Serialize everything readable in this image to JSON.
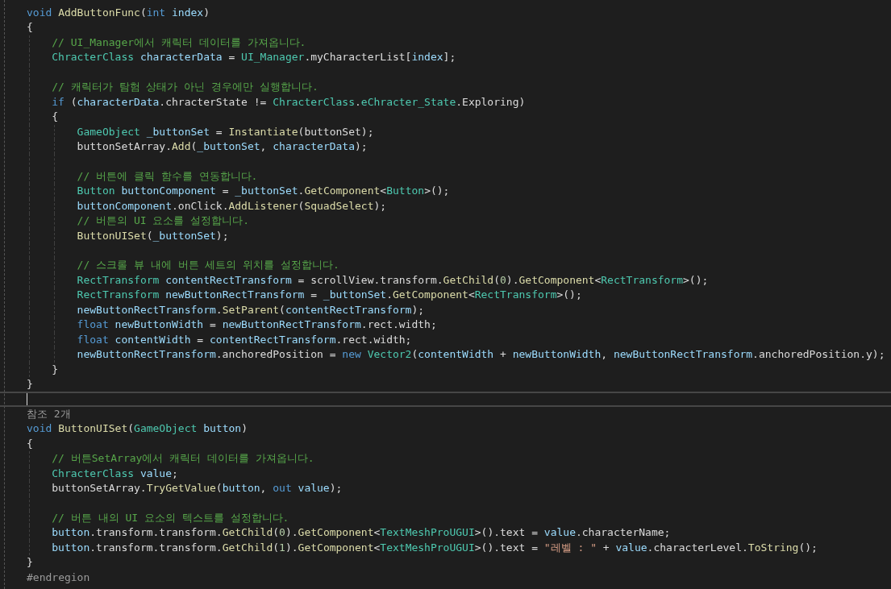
{
  "editor": {
    "lines": [
      {
        "current": false,
        "tokens": [
          {
            "text": "void ",
            "kind": "keyword"
          },
          {
            "text": "AddButtonFunc",
            "kind": "method"
          },
          {
            "text": "(",
            "kind": "plain"
          },
          {
            "text": "int ",
            "kind": "keyword"
          },
          {
            "text": "index",
            "kind": "variable"
          },
          {
            "text": ")",
            "kind": "plain"
          }
        ]
      },
      {
        "current": false,
        "tokens": [
          {
            "text": "{",
            "kind": "plain"
          }
        ],
        "children": [
          {
            "current": false,
            "tokens": [
              {
                "text": "// UI_Manager에서 캐릭터 데이터를 가져옵니다.",
                "kind": "comment"
              }
            ]
          },
          {
            "current": false,
            "tokens": [
              {
                "text": "ChracterClass ",
                "kind": "type"
              },
              {
                "text": "characterData",
                "kind": "variable"
              },
              {
                "text": " = ",
                "kind": "plain"
              },
              {
                "text": "UI_Manager",
                "kind": "type"
              },
              {
                "text": ".myCharacterList[",
                "kind": "plain"
              },
              {
                "text": "index",
                "kind": "variable"
              },
              {
                "text": "];",
                "kind": "plain"
              }
            ]
          },
          {
            "current": false
          },
          {
            "current": false,
            "tokens": [
              {
                "text": "// 캐릭터가 탐험 상태가 아닌 경우에만 실행합니다.",
                "kind": "comment"
              }
            ]
          },
          {
            "current": false,
            "tokens": [
              {
                "text": "if",
                "kind": "keyword"
              },
              {
                "text": " (",
                "kind": "plain"
              },
              {
                "text": "characterData",
                "kind": "variable"
              },
              {
                "text": ".chracterState != ",
                "kind": "plain"
              },
              {
                "text": "ChracterClass",
                "kind": "type"
              },
              {
                "text": ".",
                "kind": "plain"
              },
              {
                "text": "eChracter_State",
                "kind": "type"
              },
              {
                "text": ".Exploring)",
                "kind": "plain"
              }
            ]
          },
          {
            "current": false,
            "tokens": [
              {
                "text": "{",
                "kind": "plain"
              }
            ],
            "children": [
              {
                "current": false,
                "tokens": [
                  {
                    "text": "GameObject ",
                    "kind": "type"
                  },
                  {
                    "text": "_buttonSet",
                    "kind": "variable"
                  },
                  {
                    "text": " = ",
                    "kind": "plain"
                  },
                  {
                    "text": "Instantiate",
                    "kind": "method"
                  },
                  {
                    "text": "(buttonSet);",
                    "kind": "plain"
                  }
                ]
              },
              {
                "current": false,
                "tokens": [
                  {
                    "text": "buttonSetArray.",
                    "kind": "plain"
                  },
                  {
                    "text": "Add",
                    "kind": "method"
                  },
                  {
                    "text": "(",
                    "kind": "plain"
                  },
                  {
                    "text": "_buttonSet",
                    "kind": "variable"
                  },
                  {
                    "text": ", ",
                    "kind": "plain"
                  },
                  {
                    "text": "characterData",
                    "kind": "variable"
                  },
                  {
                    "text": ");",
                    "kind": "plain"
                  }
                ]
              },
              {
                "current": false
              },
              {
                "current": false,
                "tokens": [
                  {
                    "text": "// 버튼에 클릭 함수를 연동합니다.",
                    "kind": "comment"
                  }
                ]
              },
              {
                "current": false,
                "tokens": [
                  {
                    "text": "Button ",
                    "kind": "type"
                  },
                  {
                    "text": "buttonComponent",
                    "kind": "variable"
                  },
                  {
                    "text": " = ",
                    "kind": "plain"
                  },
                  {
                    "text": "_buttonSet",
                    "kind": "variable"
                  },
                  {
                    "text": ".",
                    "kind": "plain"
                  },
                  {
                    "text": "GetComponent",
                    "kind": "method"
                  },
                  {
                    "text": "<",
                    "kind": "plain"
                  },
                  {
                    "text": "Button",
                    "kind": "type"
                  },
                  {
                    "text": ">();",
                    "kind": "plain"
                  }
                ]
              },
              {
                "current": false,
                "tokens": [
                  {
                    "text": "buttonComponent",
                    "kind": "variable"
                  },
                  {
                    "text": ".onClick.",
                    "kind": "plain"
                  },
                  {
                    "text": "AddListener",
                    "kind": "method"
                  },
                  {
                    "text": "(",
                    "kind": "plain"
                  },
                  {
                    "text": "SquadSelect",
                    "kind": "method"
                  },
                  {
                    "text": ");",
                    "kind": "plain"
                  }
                ]
              },
              {
                "current": false,
                "tokens": [
                  {
                    "text": "// 버튼의 UI 요소를 설정합니다.",
                    "kind": "comment"
                  }
                ]
              },
              {
                "current": false,
                "tokens": [
                  {
                    "text": "ButtonUISet",
                    "kind": "method"
                  },
                  {
                    "text": "(",
                    "kind": "plain"
                  },
                  {
                    "text": "_buttonSet",
                    "kind": "variable"
                  },
                  {
                    "text": ");",
                    "kind": "plain"
                  }
                ]
              },
              {
                "current": false
              },
              {
                "current": false,
                "tokens": [
                  {
                    "text": "// 스크롤 뷰 내에 버튼 세트의 위치를 설정합니다.",
                    "kind": "comment"
                  }
                ]
              },
              {
                "current": false,
                "tokens": [
                  {
                    "text": "RectTransform ",
                    "kind": "type"
                  },
                  {
                    "text": "contentRectTransform",
                    "kind": "variable"
                  },
                  {
                    "text": " = scrollView.transform.",
                    "kind": "plain"
                  },
                  {
                    "text": "GetChild",
                    "kind": "method"
                  },
                  {
                    "text": "(",
                    "kind": "plain"
                  },
                  {
                    "text": "0",
                    "kind": "number"
                  },
                  {
                    "text": ").",
                    "kind": "plain"
                  },
                  {
                    "text": "GetComponent",
                    "kind": "method"
                  },
                  {
                    "text": "<",
                    "kind": "plain"
                  },
                  {
                    "text": "RectTransform",
                    "kind": "type"
                  },
                  {
                    "text": ">();",
                    "kind": "plain"
                  }
                ]
              },
              {
                "current": false,
                "tokens": [
                  {
                    "text": "RectTransform ",
                    "kind": "type"
                  },
                  {
                    "text": "newButtonRectTransform",
                    "kind": "variable"
                  },
                  {
                    "text": " = ",
                    "kind": "plain"
                  },
                  {
                    "text": "_buttonSet",
                    "kind": "variable"
                  },
                  {
                    "text": ".",
                    "kind": "plain"
                  },
                  {
                    "text": "GetComponent",
                    "kind": "method"
                  },
                  {
                    "text": "<",
                    "kind": "plain"
                  },
                  {
                    "text": "RectTransform",
                    "kind": "type"
                  },
                  {
                    "text": ">();",
                    "kind": "plain"
                  }
                ]
              },
              {
                "current": false,
                "tokens": [
                  {
                    "text": "newButtonRectTransform",
                    "kind": "variable"
                  },
                  {
                    "text": ".",
                    "kind": "plain"
                  },
                  {
                    "text": "SetParent",
                    "kind": "method"
                  },
                  {
                    "text": "(",
                    "kind": "plain"
                  },
                  {
                    "text": "contentRectTransform",
                    "kind": "variable"
                  },
                  {
                    "text": ");",
                    "kind": "plain"
                  }
                ]
              },
              {
                "current": false,
                "tokens": [
                  {
                    "text": "float ",
                    "kind": "keyword"
                  },
                  {
                    "text": "newButtonWidth",
                    "kind": "variable"
                  },
                  {
                    "text": " = ",
                    "kind": "plain"
                  },
                  {
                    "text": "newButtonRectTransform",
                    "kind": "variable"
                  },
                  {
                    "text": ".rect.width;",
                    "kind": "plain"
                  }
                ]
              },
              {
                "current": false,
                "tokens": [
                  {
                    "text": "float ",
                    "kind": "keyword"
                  },
                  {
                    "text": "contentWidth",
                    "kind": "variable"
                  },
                  {
                    "text": " = ",
                    "kind": "plain"
                  },
                  {
                    "text": "contentRectTransform",
                    "kind": "variable"
                  },
                  {
                    "text": ".rect.width;",
                    "kind": "plain"
                  }
                ]
              },
              {
                "current": false,
                "tokens": [
                  {
                    "text": "newButtonRectTransform",
                    "kind": "variable"
                  },
                  {
                    "text": ".anchoredPosition = ",
                    "kind": "plain"
                  },
                  {
                    "text": "new ",
                    "kind": "keyword"
                  },
                  {
                    "text": "Vector2",
                    "kind": "type"
                  },
                  {
                    "text": "(",
                    "kind": "plain"
                  },
                  {
                    "text": "contentWidth",
                    "kind": "variable"
                  },
                  {
                    "text": " + ",
                    "kind": "plain"
                  },
                  {
                    "text": "newButtonWidth",
                    "kind": "variable"
                  },
                  {
                    "text": ", ",
                    "kind": "plain"
                  },
                  {
                    "text": "newButtonRectTransform",
                    "kind": "variable"
                  },
                  {
                    "text": ".anchoredPosition.y);",
                    "kind": "plain"
                  }
                ]
              }
            ]
          },
          {
            "current": false,
            "tokens": [
              {
                "text": "}",
                "kind": "plain"
              }
            ]
          }
        ]
      },
      {
        "current": false,
        "tokens": [
          {
            "text": "}",
            "kind": "plain"
          }
        ]
      },
      {
        "current": true
      },
      {
        "current": false,
        "tokens": [
          {
            "text": "참조 2개",
            "kind": "lens"
          }
        ]
      },
      {
        "current": false,
        "tokens": [
          {
            "text": "void ",
            "kind": "keyword"
          },
          {
            "text": "ButtonUISet",
            "kind": "method"
          },
          {
            "text": "(",
            "kind": "plain"
          },
          {
            "text": "GameObject ",
            "kind": "type"
          },
          {
            "text": "button",
            "kind": "variable"
          },
          {
            "text": ")",
            "kind": "plain"
          }
        ]
      },
      {
        "current": false,
        "tokens": [
          {
            "text": "{",
            "kind": "plain"
          }
        ],
        "children": [
          {
            "current": false,
            "tokens": [
              {
                "text": "// 버튼SetArray에서 캐릭터 데이터를 가져옵니다.",
                "kind": "comment"
              }
            ]
          },
          {
            "current": false,
            "tokens": [
              {
                "text": "ChracterClass ",
                "kind": "type"
              },
              {
                "text": "value",
                "kind": "variable"
              },
              {
                "text": ";",
                "kind": "plain"
              }
            ]
          },
          {
            "current": false,
            "tokens": [
              {
                "text": "buttonSetArray.",
                "kind": "plain"
              },
              {
                "text": "TryGetValue",
                "kind": "method"
              },
              {
                "text": "(",
                "kind": "plain"
              },
              {
                "text": "button",
                "kind": "variable"
              },
              {
                "text": ", ",
                "kind": "plain"
              },
              {
                "text": "out ",
                "kind": "keyword"
              },
              {
                "text": "value",
                "kind": "variable"
              },
              {
                "text": ");",
                "kind": "plain"
              }
            ]
          },
          {
            "current": false
          },
          {
            "current": false,
            "tokens": [
              {
                "text": "// 버튼 내의 UI 요소의 텍스트를 설정합니다.",
                "kind": "comment"
              }
            ]
          },
          {
            "current": false,
            "tokens": [
              {
                "text": "button",
                "kind": "variable"
              },
              {
                "text": ".transform.transform.",
                "kind": "plain"
              },
              {
                "text": "GetChild",
                "kind": "method"
              },
              {
                "text": "(",
                "kind": "plain"
              },
              {
                "text": "0",
                "kind": "number"
              },
              {
                "text": ").",
                "kind": "plain"
              },
              {
                "text": "GetComponent",
                "kind": "method"
              },
              {
                "text": "<",
                "kind": "plain"
              },
              {
                "text": "TextMeshProUGUI",
                "kind": "type"
              },
              {
                "text": ">().text = ",
                "kind": "plain"
              },
              {
                "text": "value",
                "kind": "variable"
              },
              {
                "text": ".characterName;",
                "kind": "plain"
              }
            ]
          },
          {
            "current": false,
            "tokens": [
              {
                "text": "button",
                "kind": "variable"
              },
              {
                "text": ".transform.transform.",
                "kind": "plain"
              },
              {
                "text": "GetChild",
                "kind": "method"
              },
              {
                "text": "(",
                "kind": "plain"
              },
              {
                "text": "1",
                "kind": "number"
              },
              {
                "text": ").",
                "kind": "plain"
              },
              {
                "text": "GetComponent",
                "kind": "method"
              },
              {
                "text": "<",
                "kind": "plain"
              },
              {
                "text": "TextMeshProUGUI",
                "kind": "type"
              },
              {
                "text": ">().text = ",
                "kind": "plain"
              },
              {
                "text": "\"레벨 : \"",
                "kind": "string"
              },
              {
                "text": " + ",
                "kind": "plain"
              },
              {
                "text": "value",
                "kind": "variable"
              },
              {
                "text": ".characterLevel.",
                "kind": "plain"
              },
              {
                "text": "ToString",
                "kind": "method"
              },
              {
                "text": "();",
                "kind": "plain"
              }
            ]
          }
        ]
      },
      {
        "current": false,
        "tokens": [
          {
            "text": "}",
            "kind": "plain"
          }
        ]
      },
      {
        "current": false,
        "tokens": [
          {
            "text": "#endregion",
            "kind": "directive"
          }
        ]
      }
    ]
  }
}
